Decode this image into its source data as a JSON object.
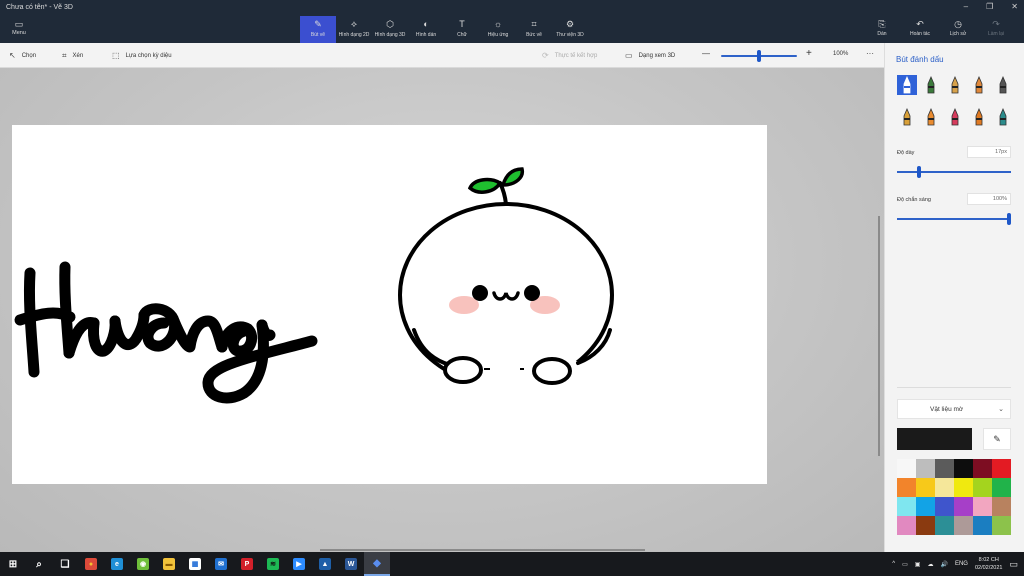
{
  "window": {
    "title": "Chưa có tên* - Vẽ 3D",
    "controls": [
      "–",
      "❐",
      "✕"
    ]
  },
  "ribbon": {
    "menu_label": "Menu",
    "tools": [
      {
        "label": "Bút vẽ",
        "icon": "brush-icon",
        "glyph": "✎",
        "active": true
      },
      {
        "label": "Hình dạng 2D",
        "icon": "shapes-2d-icon",
        "glyph": "⟡",
        "active": false
      },
      {
        "label": "Hình dạng 3D",
        "icon": "cube-icon",
        "glyph": "⬡",
        "active": false
      },
      {
        "label": "Hình dán",
        "icon": "sticker-icon",
        "glyph": "◐",
        "active": false
      },
      {
        "label": "Chữ",
        "icon": "text-icon",
        "glyph": "T",
        "active": false
      },
      {
        "label": "Hiệu ứng",
        "icon": "effects-icon",
        "glyph": "☼",
        "active": false
      },
      {
        "label": "Bức vẽ",
        "icon": "canvas-icon",
        "glyph": "⌗",
        "active": false
      },
      {
        "label": "Thư viện 3D",
        "icon": "library-icon",
        "glyph": "⚙",
        "active": false
      }
    ],
    "right_tools": [
      {
        "label": "Dán",
        "icon": "paste-icon",
        "glyph": "⎘",
        "enabled": true
      },
      {
        "label": "Hoàn tác",
        "icon": "undo-icon",
        "glyph": "↶",
        "enabled": true
      },
      {
        "label": "Lịch sử",
        "icon": "history-icon",
        "glyph": "◷",
        "enabled": true
      },
      {
        "label": "Làm lại",
        "icon": "redo-icon",
        "glyph": "↷",
        "enabled": false
      }
    ]
  },
  "toolbar": {
    "select_label": "Chọn",
    "crop_label": "Xén",
    "magic_select_label": "Lựa chọn kỳ diệu",
    "mixed_reality_label": "Thực tế kết hợp",
    "view3d_label": "Dạng xem 3D",
    "zoom_minus": "—",
    "zoom_plus": "+",
    "zoom_value": "100%",
    "zoom_level": 0.5,
    "more": "···"
  },
  "panel": {
    "title": "Bút đánh dấu",
    "brushes": [
      {
        "name": "marker-icon",
        "color": "#222222"
      },
      {
        "name": "calligraphy-pen-icon",
        "color": "#3b7a3b"
      },
      {
        "name": "oil-brush-icon",
        "color": "#d8a24a"
      },
      {
        "name": "watercolor-icon",
        "color": "#e0883a"
      },
      {
        "name": "pencil-icon",
        "color": "#555555"
      },
      {
        "name": "eraser-pencil-icon",
        "color": "#d9a038"
      },
      {
        "name": "crayon-icon",
        "color": "#e98b2f"
      },
      {
        "name": "pixel-pen-icon",
        "color": "#d63b5c"
      },
      {
        "name": "spray-can-icon",
        "color": "#e07a22"
      },
      {
        "name": "fill-icon",
        "color": "#2b8c8c"
      }
    ],
    "thickness_label": "Độ dày",
    "thickness_value": "17px",
    "thickness_level": 0.18,
    "opacity_label": "Độ chắn sáng",
    "opacity_value": "100%",
    "opacity_level": 1.0,
    "material_label": "Vật liệu mờ",
    "current_color": "#1a1a1a",
    "eyedropper": "✎",
    "palette": [
      "#f7f7f7",
      "#bdbdbd",
      "#5b5b5b",
      "#0d0d0d",
      "#7d0d22",
      "#e31b23",
      "#f2842b",
      "#f7c91a",
      "#f5e79a",
      "#f0e90f",
      "#a4d41e",
      "#21b34a",
      "#7fe6ef",
      "#12a3e6",
      "#3f55cc",
      "#a63fc8",
      "#f2a6c0",
      "#b8825f",
      "#e189c0",
      "#8a3a10",
      "#2c8f96",
      "#ad9a98",
      "#1b7ec1",
      "#8cc24b"
    ]
  },
  "drawing": {
    "text": "Hương",
    "leaf_color": "#1fbf2f",
    "blush_color": "#f7b7b2"
  },
  "taskbar": {
    "apps": [
      {
        "name": "start-icon",
        "glyph": "⊞",
        "bg": "",
        "fg": "#ffffff"
      },
      {
        "name": "search-icon",
        "glyph": "⌕",
        "bg": "",
        "fg": "#ffffff"
      },
      {
        "name": "task-view-icon",
        "glyph": "❏",
        "bg": "",
        "fg": "#ffffff"
      },
      {
        "name": "chrome-icon",
        "glyph": "●",
        "bg": "#dd4a3a",
        "fg": "#f4c430"
      },
      {
        "name": "edge-icon",
        "glyph": "e",
        "bg": "#1f8fd6",
        "fg": "#ffffff"
      },
      {
        "name": "coc-coc-icon",
        "glyph": "◉",
        "bg": "#6fbf3b",
        "fg": "#ffffff"
      },
      {
        "name": "file-explorer-icon",
        "glyph": "▬",
        "bg": "#f2c23a",
        "fg": "#8a5a00"
      },
      {
        "name": "store-icon",
        "glyph": "▦",
        "bg": "#ffffff",
        "fg": "#1e6bd6"
      },
      {
        "name": "mail-icon",
        "glyph": "✉",
        "bg": "#2070d0",
        "fg": "#ffffff"
      },
      {
        "name": "pinterest-icon",
        "glyph": "P",
        "bg": "#d3202a",
        "fg": "#ffffff"
      },
      {
        "name": "spotify-icon",
        "glyph": "≋",
        "bg": "#1db954",
        "fg": "#111111"
      },
      {
        "name": "zoom-icon",
        "glyph": "▶",
        "bg": "#2d8cff",
        "fg": "#ffffff"
      },
      {
        "name": "photos-icon",
        "glyph": "▲",
        "bg": "#1e5fa8",
        "fg": "#ffffff"
      },
      {
        "name": "word-icon",
        "glyph": "W",
        "bg": "#2b5797",
        "fg": "#ffffff"
      },
      {
        "name": "paint3d-icon",
        "glyph": "◆",
        "bg": "",
        "fg": "#5a8dee",
        "active": true
      }
    ],
    "tray_icons": [
      "^",
      "▭",
      "▣",
      "☁",
      "🔊",
      "ENG"
    ],
    "time": "8:02 CH",
    "date": "02/02/2021",
    "notification": "▭"
  }
}
